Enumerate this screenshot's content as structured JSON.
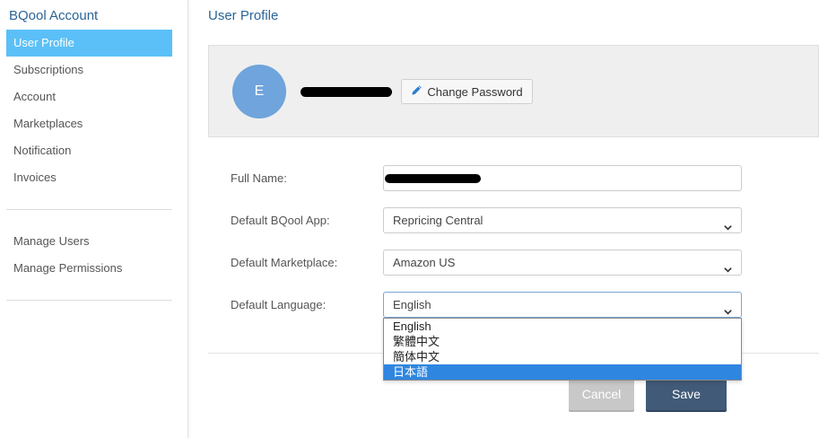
{
  "sidebar": {
    "title": "BQool Account",
    "items": [
      {
        "label": "User Profile",
        "active": true
      },
      {
        "label": "Subscriptions"
      },
      {
        "label": "Account"
      },
      {
        "label": "Marketplaces"
      },
      {
        "label": "Notification"
      },
      {
        "label": "Invoices"
      }
    ],
    "manage_items": [
      {
        "label": "Manage Users"
      },
      {
        "label": "Manage Permissions"
      }
    ]
  },
  "main": {
    "title": "User Profile",
    "profile": {
      "avatar_initial": "E",
      "change_password_label": "Change Password"
    },
    "form": {
      "full_name_label": "Full Name:",
      "default_app_label": "Default BQool App:",
      "default_app_value": "Repricing Central",
      "default_marketplace_label": "Default Marketplace:",
      "default_marketplace_value": "Amazon US",
      "default_language_label": "Default Language:",
      "default_language_value": "English",
      "language_options": [
        "English",
        "繁體中文",
        "簡体中文",
        "日本語"
      ]
    },
    "buttons": {
      "cancel_label": "Cancel",
      "save_label": "Save"
    }
  },
  "colors": {
    "active_nav": "#5bc0f8",
    "link_blue": "#2a6496",
    "avatar": "#6fa4dc",
    "save_button": "#415a78",
    "cancel_button": "#c8c8c8",
    "dropdown_highlight": "#2f86e0"
  },
  "icons": {
    "change_password": "pencil-icon",
    "select": "chevron-down-icon"
  }
}
